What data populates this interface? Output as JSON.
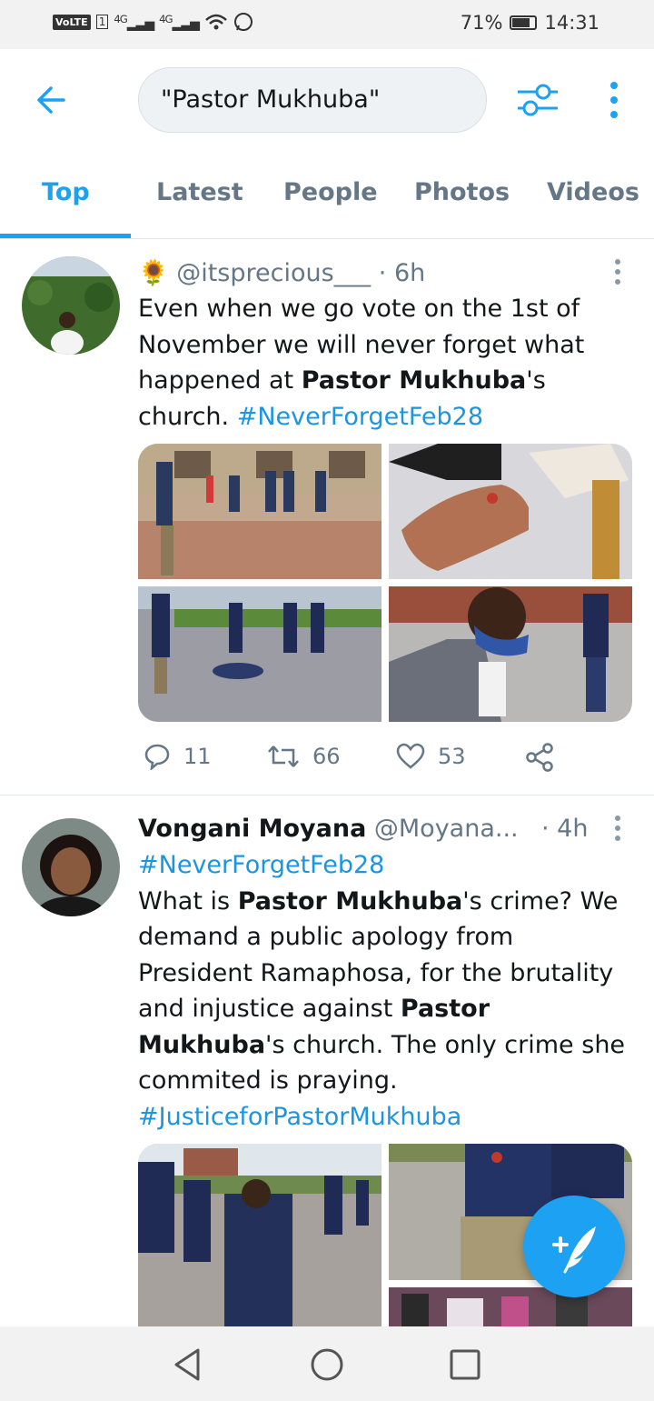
{
  "status_bar": {
    "carrier_badge": "VoLTE",
    "sim_slot": "1",
    "signal_1": "4G",
    "signal_2": "4G",
    "battery": "71%",
    "time": "14:31"
  },
  "search": {
    "query": "\"Pastor Mukhuba\""
  },
  "tabs": [
    {
      "label": "Top",
      "active": true
    },
    {
      "label": "Latest",
      "active": false
    },
    {
      "label": "People",
      "active": false
    },
    {
      "label": "Photos",
      "active": false
    },
    {
      "label": "Videos",
      "active": false
    }
  ],
  "tweets": [
    {
      "emoji": "🌻",
      "handle": "@itsprecious___",
      "time": "· 6h",
      "text_parts": {
        "p1": "Even when we go vote on the 1st of November we will never forget what happened at ",
        "bold1": "Pastor Mukhuba",
        "p2": "'s church. ",
        "hashtag": "#NeverForgetFeb28"
      },
      "replies": "11",
      "retweets": "66",
      "likes": "53"
    },
    {
      "name": "Vongani Moyana",
      "handle": "@Moyana...",
      "time": "· 4h",
      "hashtag1": "#NeverForgetFeb28",
      "text_parts": {
        "p1": "What is ",
        "bold1": "Pastor Mukhuba",
        "p2": "'s crime? We demand a public apology from President Ramaphosa, for the brutality and injustice against ",
        "bold2": "Pastor Mukhuba",
        "p3": "'s church. The only crime she commited is praying.",
        "hashtag2": "#JusticeforPastorMukhuba"
      }
    }
  ],
  "icons": {
    "back": "back-arrow-icon",
    "filter": "filter-sliders-icon",
    "more": "more-vertical-icon",
    "reply": "reply-icon",
    "retweet": "retweet-icon",
    "like": "heart-icon",
    "share": "share-icon",
    "compose": "compose-tweet-icon"
  },
  "colors": {
    "accent": "#1da1f2",
    "hashtag": "#1b95e0",
    "muted": "#657786"
  }
}
